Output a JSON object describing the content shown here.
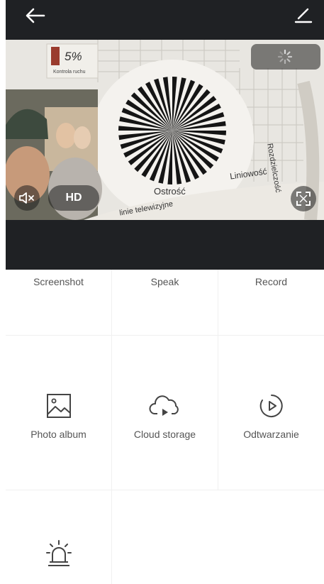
{
  "header": {
    "back_icon": "arrow-left-icon",
    "edit_icon": "pencil-icon"
  },
  "video": {
    "overlay_percent": "5%",
    "overlay_caption": "Kontrola ruchu",
    "label_sharpness": "Ostrość",
    "label_linearity": "Liniowość",
    "label_resolution": "Rozdzielczość",
    "label_lines": "linie telewizyjne",
    "quality_label": "HD",
    "mute_icon": "speaker-mute-icon",
    "fullscreen_icon": "fullscreen-icon",
    "loading_icon": "spinner-icon"
  },
  "controls": {
    "screenshot": "Screenshot",
    "speak": "Speak",
    "record": "Record",
    "photo_album": "Photo album",
    "cloud_storage": "Cloud storage",
    "playback": "Odtwarzanie"
  },
  "colors": {
    "bar": "#1f2124",
    "text": "#555555",
    "divider": "#f0f0f0"
  }
}
